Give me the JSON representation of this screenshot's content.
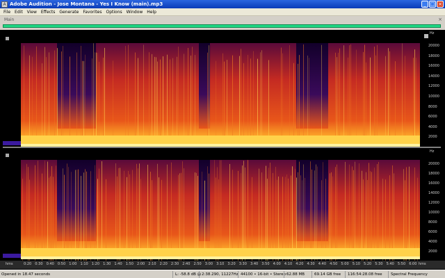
{
  "window": {
    "title": "Adobe Audition - Jose Montana - Yes I Know (main).mp3",
    "app_icon": "audition-app-icon"
  },
  "window_controls": {
    "minimize": "_",
    "maximize": "□",
    "close": "×"
  },
  "menu": [
    "File",
    "Edit",
    "View",
    "Effects",
    "Generate",
    "Favorites",
    "Options",
    "Window",
    "Help"
  ],
  "panel": {
    "tab_label": "Main",
    "close_glyph": "×"
  },
  "freq_axis": {
    "unit": "Hz",
    "labels": [
      "20000",
      "18000",
      "16000",
      "14000",
      "12000",
      "10000",
      "8000",
      "6000",
      "4000",
      "2000"
    ]
  },
  "time_ruler": {
    "unit": "hms",
    "labels": [
      "0:20",
      "0:30",
      "0:40",
      "0:50",
      "1:00",
      "1:10",
      "1:20",
      "1:30",
      "1:40",
      "1:50",
      "2:00",
      "2:10",
      "2:20",
      "2:30",
      "2:40",
      "2:50",
      "3:00",
      "3:10",
      "3:20",
      "3:30",
      "3:40",
      "3:50",
      "4:00",
      "4:10",
      "4:20",
      "4:30",
      "4:40",
      "4:50",
      "5:00",
      "5:10",
      "5:20",
      "5:30",
      "5:40",
      "5:50",
      "6:00"
    ],
    "end_label": "hms"
  },
  "status": {
    "opened": "Opened in 18.47 seconds",
    "level": "L: -58.8 dB @",
    "cursor": "2:38.290, 11227Hz",
    "format": "44100 • 16-bit • Stereo",
    "size": "62.88 MB",
    "free": "69.14 GB free",
    "time_free": "116:54:28.08 free",
    "view": "Spectral Frequency"
  },
  "colors": {
    "spectrum_low": "#1a0033",
    "spectrum_mid": "#d8421a",
    "spectrum_high": "#ffe066",
    "overview_green": "#1fd884"
  }
}
